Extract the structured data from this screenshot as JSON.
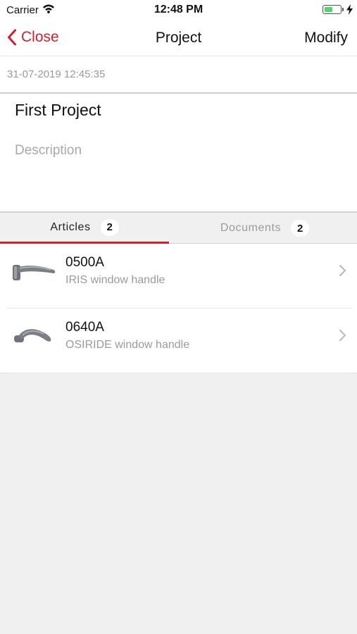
{
  "status_bar": {
    "carrier": "Carrier",
    "time": "12:48 PM",
    "battery_level": 0.55,
    "wifi_icon": "wifi-icon",
    "charging_icon": "bolt-icon"
  },
  "nav": {
    "back_label": "Close",
    "title": "Project",
    "action_label": "Modify",
    "accent_color": "#d0202e"
  },
  "project": {
    "date": "31-07-2019 12:45:35",
    "name": "First Project",
    "description_placeholder": "Description"
  },
  "tabs": [
    {
      "label": "Articles",
      "count": "2",
      "active": true
    },
    {
      "label": "Documents",
      "count": "2",
      "active": false
    }
  ],
  "articles": [
    {
      "code": "0500A",
      "name": "IRIS window handle",
      "icon": "window-handle-icon"
    },
    {
      "code": "0640A",
      "name": "OSIRIDE window handle",
      "icon": "window-handle-icon"
    }
  ]
}
